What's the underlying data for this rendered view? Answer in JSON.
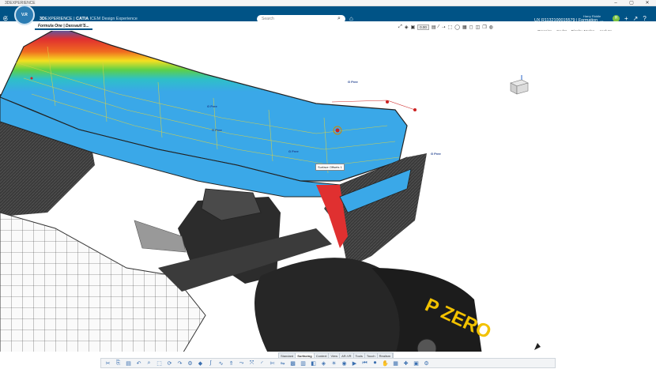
{
  "window": {
    "title": "3DEXPERIENCE",
    "min": "–",
    "max": "▢",
    "close": "✕"
  },
  "topbar": {
    "brand_prefix": "3D",
    "brand_exp": "EXPERIENCE",
    "brand_app": "CATIA",
    "brand_role": "ICEM Design Experience",
    "compass_label": "V.R",
    "search_placeholder": "Search",
    "user_name": "Harry Riddle",
    "context": "UX R1132100015579 | Formation_...",
    "avatar_letter": "H"
  },
  "tab": {
    "label": "Formula One | Dassault S...",
    "add": "+"
  },
  "toolbar": {
    "zoom": "0.00"
  },
  "panel_tabs": [
    "Organize",
    "Sculpt",
    "Display Modes",
    "Analyze"
  ],
  "viewport": {
    "labels": [
      {
        "text": "G Free"
      },
      {
        "text": "G Free"
      },
      {
        "text": "G Free"
      },
      {
        "text": "G Free"
      },
      {
        "text": "G Free"
      }
    ],
    "tag_text": "Surface Offsets 1",
    "tire_text": "P ZERO"
  },
  "command_tabs": [
    "Standard",
    "Surfacing",
    "Context",
    "View",
    "AR-VR",
    "Tools",
    "Touch",
    "Realism"
  ],
  "active_command_tab": "Surfacing",
  "colors": {
    "topbar": "#005386",
    "analysis_blue": "#3aa8e8",
    "tire_yellow": "#f2c200"
  }
}
